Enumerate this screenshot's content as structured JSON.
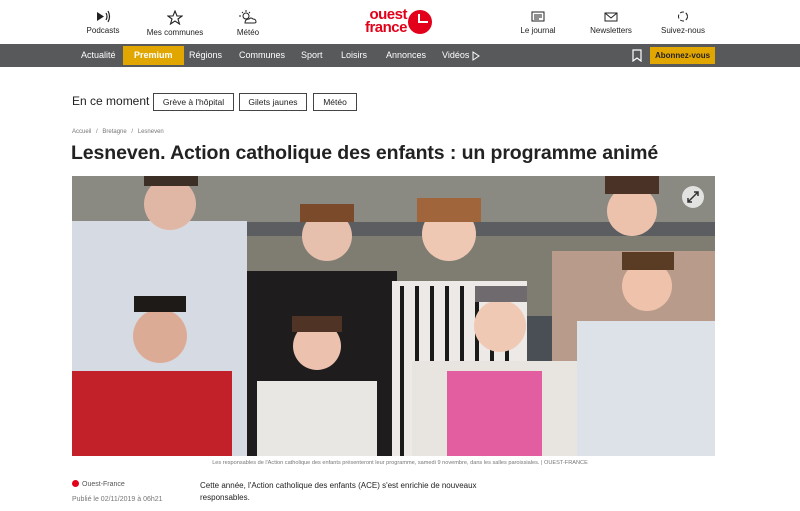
{
  "topnav": {
    "podcasts": "Podcasts",
    "communes": "Mes communes",
    "meteo": "Météo",
    "journal": "Le journal",
    "newsletters": "Newsletters",
    "suivez": "Suivez-nous"
  },
  "logo": {
    "line1": "ouest",
    "line2": "france",
    "color": "#e2001a"
  },
  "menu": {
    "items": [
      "Actualité",
      "Premium",
      "Régions",
      "Communes",
      "Sport",
      "Loisirs",
      "Annonces",
      "Vidéos"
    ],
    "subscribe": "Abonnez-vous",
    "premium_color": "#e2a600",
    "bar_color": "#58595b"
  },
  "moment": {
    "label": "En ce moment",
    "chips": [
      "Grève à l'hôpital",
      "Gilets jaunes",
      "Météo"
    ]
  },
  "breadcrumb": [
    "Accueil",
    "/",
    "Bretagne",
    "/",
    "Lesneven"
  ],
  "article": {
    "title": "Lesneven. Action catholique des enfants : un programme animé",
    "caption": "Les responsables de l'Action catholique des enfants présenteront leur programme, samedi 9 novembre, dans les salles paroissiales. | OUEST-FRANCE",
    "source": "Ouest-France",
    "published": "Publié le 02/11/2019 à 06h21",
    "intro": "Cette année, l'Action catholique des enfants (ACE) s'est enrichie de nouveaux responsables."
  }
}
